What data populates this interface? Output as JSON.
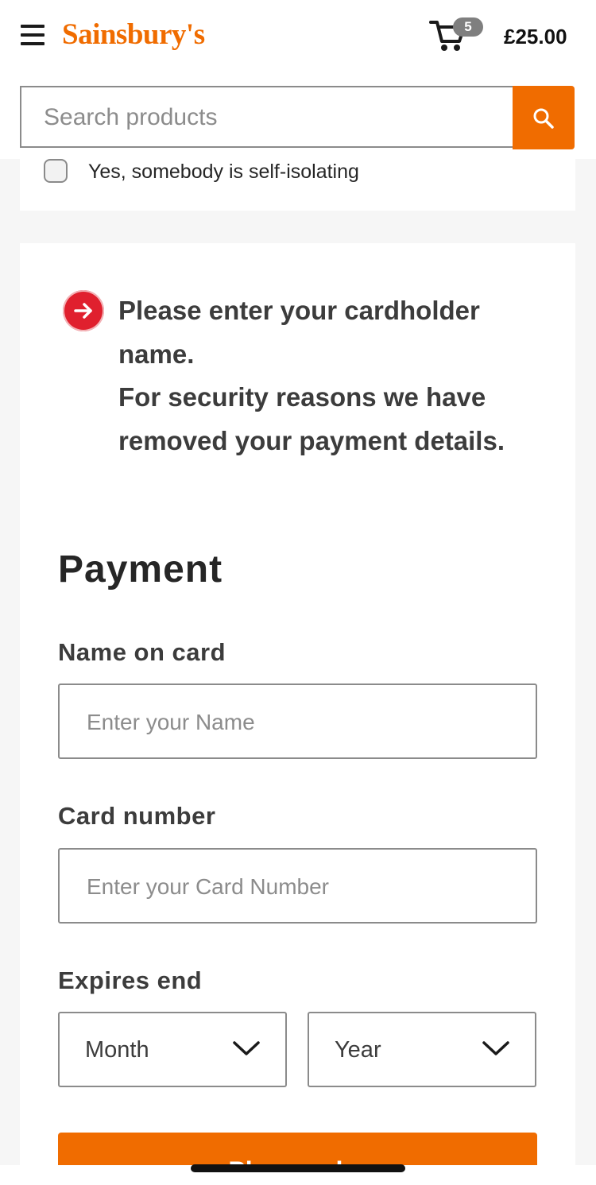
{
  "header": {
    "brand": "Sainsbury's",
    "cart": {
      "count": "5",
      "total": "£25.00"
    },
    "search": {
      "placeholder": "Search products"
    }
  },
  "isolation": {
    "checkbox_label": "Yes, somebody is self-isolating",
    "checked": false
  },
  "alert": {
    "line1": "Please enter your cardholder name.",
    "line2": "For security reasons we have removed your payment details."
  },
  "payment": {
    "title": "Payment",
    "name_label": "Name on card",
    "name_placeholder": "Enter your Name",
    "card_label": "Card number",
    "card_placeholder": "Enter your Card Number",
    "expires_label": "Expires end",
    "month_value": "Month",
    "year_value": "Year",
    "submit_label": "Place order"
  },
  "colors": {
    "brand": "#f06c00",
    "alert": "#e0202e"
  }
}
